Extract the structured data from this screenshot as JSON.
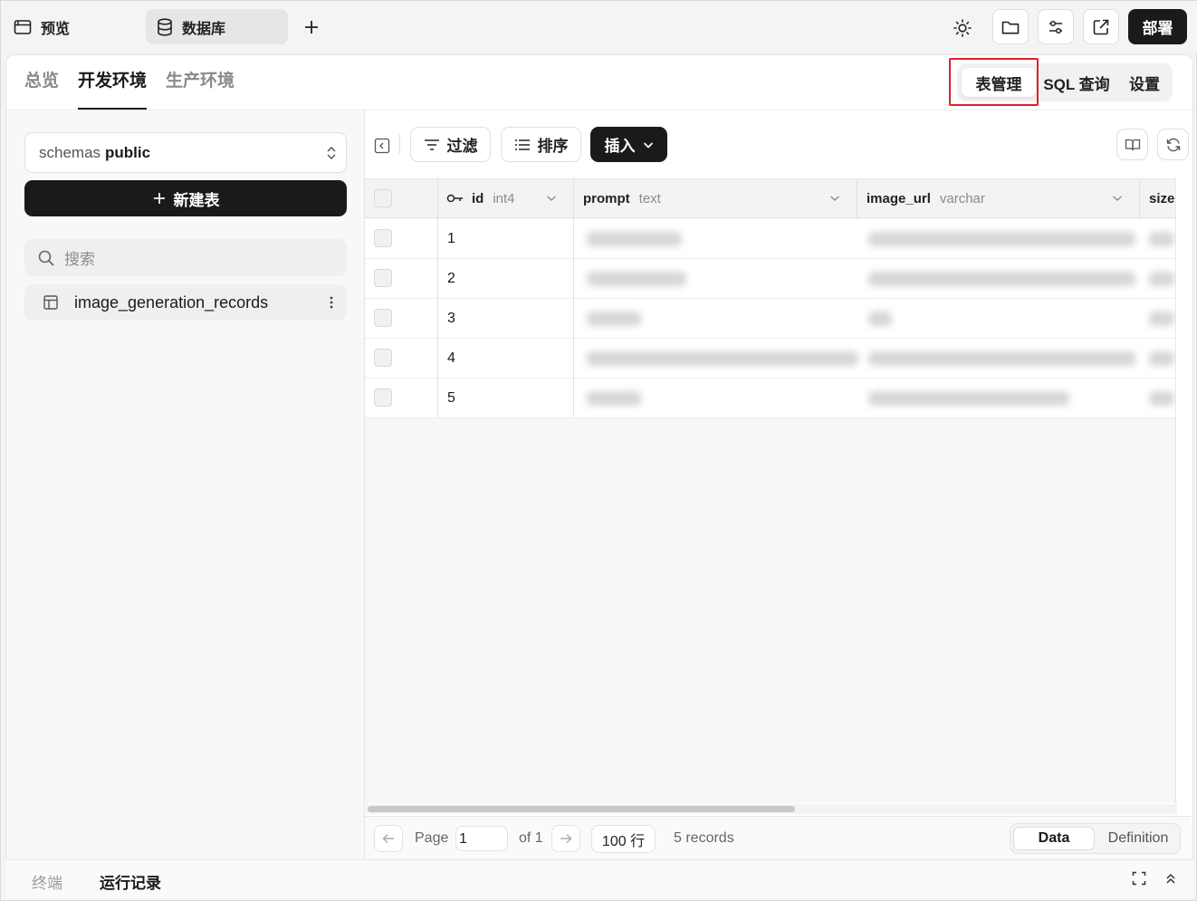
{
  "topbar": {
    "tabs": [
      {
        "label": "预览",
        "icon": "window-icon"
      },
      {
        "label": "数据库",
        "icon": "database-icon",
        "active": true
      }
    ],
    "add_tab_icon": "plus-icon",
    "actions": [
      "sun-icon",
      "folder-icon",
      "sliders-icon",
      "external-link-icon"
    ],
    "deploy_label": "部署"
  },
  "env_tabs": [
    "总览",
    "开发环境",
    "生产环境"
  ],
  "env_active": "开发环境",
  "segmented": {
    "items": [
      "表管理",
      "SQL 查询",
      "设置"
    ],
    "active": "表管理"
  },
  "sidebar": {
    "schema_prefix": "schemas",
    "schema_value": "public",
    "new_table_label": "新建表",
    "search_placeholder": "搜索",
    "tables": [
      {
        "name": "image_generation_records"
      }
    ]
  },
  "toolbar": {
    "filter_label": "过滤",
    "sort_label": "排序",
    "insert_label": "插入"
  },
  "grid": {
    "columns": [
      {
        "name": "id",
        "type": "int4",
        "primary_key": true
      },
      {
        "name": "prompt",
        "type": "text"
      },
      {
        "name": "image_url",
        "type": "varchar"
      },
      {
        "name": "size",
        "type": ""
      }
    ],
    "rows": [
      {
        "id": "1"
      },
      {
        "id": "2"
      },
      {
        "id": "3"
      },
      {
        "id": "4"
      },
      {
        "id": "5"
      }
    ]
  },
  "pager": {
    "page_label": "Page",
    "page_value": "1",
    "of_label": "of 1",
    "rows_label": "100 行",
    "records_label": "5 records",
    "view_data": "Data",
    "view_definition": "Definition",
    "view_active": "Data"
  },
  "bottom": {
    "tabs": [
      "终端",
      "运行记录"
    ],
    "active": "运行记录"
  },
  "colors": {
    "accent_dark": "#1a1a1a",
    "highlight": "#e0202a"
  }
}
